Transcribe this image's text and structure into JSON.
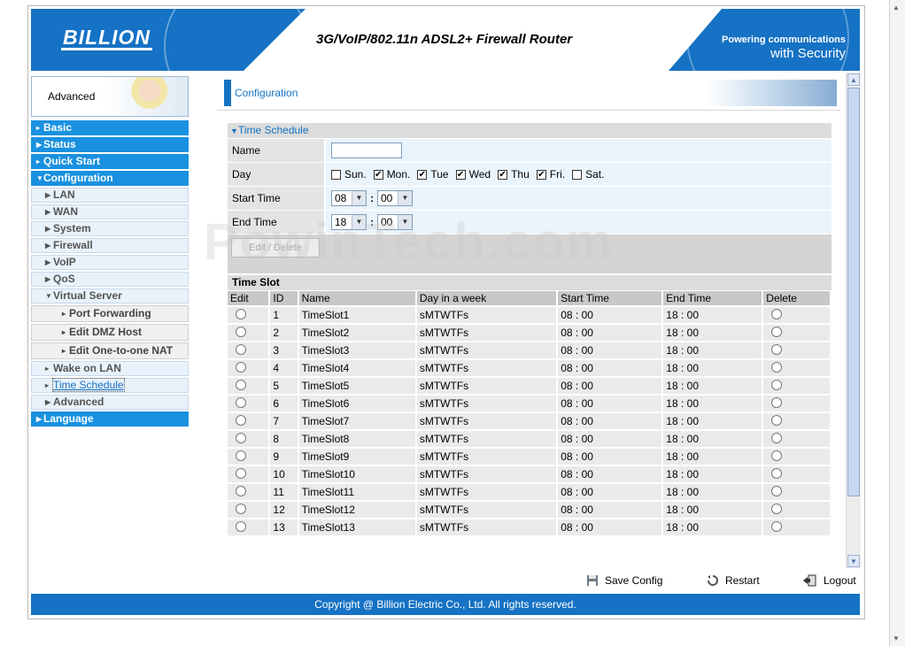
{
  "header": {
    "logo": "BILLION",
    "title": "3G/VoIP/802.11n ADSL2+ Firewall Router",
    "tagline_1": "Powering communications",
    "tagline_2": "with Security"
  },
  "sidebar": {
    "banner_label": "Advanced",
    "items": [
      {
        "label": "Basic"
      },
      {
        "label": "Status"
      },
      {
        "label": "Quick Start"
      },
      {
        "label": "Configuration"
      },
      {
        "label": "LAN"
      },
      {
        "label": "WAN"
      },
      {
        "label": "System"
      },
      {
        "label": "Firewall"
      },
      {
        "label": "VoIP"
      },
      {
        "label": "QoS"
      },
      {
        "label": "Virtual Server"
      },
      {
        "label": "Port Forwarding"
      },
      {
        "label": "Edit DMZ Host"
      },
      {
        "label": "Edit One-to-one NAT"
      },
      {
        "label": "Wake on LAN"
      },
      {
        "label": "Time Schedule"
      },
      {
        "label": "Advanced"
      },
      {
        "label": "Language"
      }
    ]
  },
  "content": {
    "page_title": "Configuration",
    "section_title": "Time Schedule",
    "form": {
      "name_label": "Name",
      "name_value": "",
      "day_label": "Day",
      "days": [
        {
          "label": "Sun.",
          "checked": false
        },
        {
          "label": "Mon.",
          "checked": true
        },
        {
          "label": "Tue",
          "checked": true
        },
        {
          "label": "Wed",
          "checked": true
        },
        {
          "label": "Thu",
          "checked": true
        },
        {
          "label": "Fri.",
          "checked": true
        },
        {
          "label": "Sat.",
          "checked": false
        }
      ],
      "start_label": "Start Time",
      "start_hour": "08",
      "start_min": "00",
      "end_label": "End Time",
      "end_hour": "18",
      "end_min": "00",
      "colon": ":",
      "edit_delete_button": "Edit / Delete"
    },
    "timeslot_title": "Time Slot",
    "columns": [
      "Edit",
      "ID",
      "Name",
      "Day in a week",
      "Start Time",
      "End Time",
      "Delete"
    ],
    "rows": [
      {
        "id": "1",
        "name": "TimeSlot1",
        "days": "sMTWTFs",
        "start": "08 : 00",
        "end": "18 : 00"
      },
      {
        "id": "2",
        "name": "TimeSlot2",
        "days": "sMTWTFs",
        "start": "08 : 00",
        "end": "18 : 00"
      },
      {
        "id": "3",
        "name": "TimeSlot3",
        "days": "sMTWTFs",
        "start": "08 : 00",
        "end": "18 : 00"
      },
      {
        "id": "4",
        "name": "TimeSlot4",
        "days": "sMTWTFs",
        "start": "08 : 00",
        "end": "18 : 00"
      },
      {
        "id": "5",
        "name": "TimeSlot5",
        "days": "sMTWTFs",
        "start": "08 : 00",
        "end": "18 : 00"
      },
      {
        "id": "6",
        "name": "TimeSlot6",
        "days": "sMTWTFs",
        "start": "08 : 00",
        "end": "18 : 00"
      },
      {
        "id": "7",
        "name": "TimeSlot7",
        "days": "sMTWTFs",
        "start": "08 : 00",
        "end": "18 : 00"
      },
      {
        "id": "8",
        "name": "TimeSlot8",
        "days": "sMTWTFs",
        "start": "08 : 00",
        "end": "18 : 00"
      },
      {
        "id": "9",
        "name": "TimeSlot9",
        "days": "sMTWTFs",
        "start": "08 : 00",
        "end": "18 : 00"
      },
      {
        "id": "10",
        "name": "TimeSlot10",
        "days": "sMTWTFs",
        "start": "08 : 00",
        "end": "18 : 00"
      },
      {
        "id": "11",
        "name": "TimeSlot11",
        "days": "sMTWTFs",
        "start": "08 : 00",
        "end": "18 : 00"
      },
      {
        "id": "12",
        "name": "TimeSlot12",
        "days": "sMTWTFs",
        "start": "08 : 00",
        "end": "18 : 00"
      },
      {
        "id": "13",
        "name": "TimeSlot13",
        "days": "sMTWTFs",
        "start": "08 : 00",
        "end": "18 : 00"
      }
    ]
  },
  "footer": {
    "save_label": "Save Config",
    "restart_label": "Restart",
    "logout_label": "Logout",
    "copyright": "Copyright @ Billion Electric Co., Ltd. All rights reserved."
  },
  "watermark": "PowinTech.com",
  "colors": {
    "brand_blue": "#1572c4",
    "menu_blue": "#1991e0"
  }
}
